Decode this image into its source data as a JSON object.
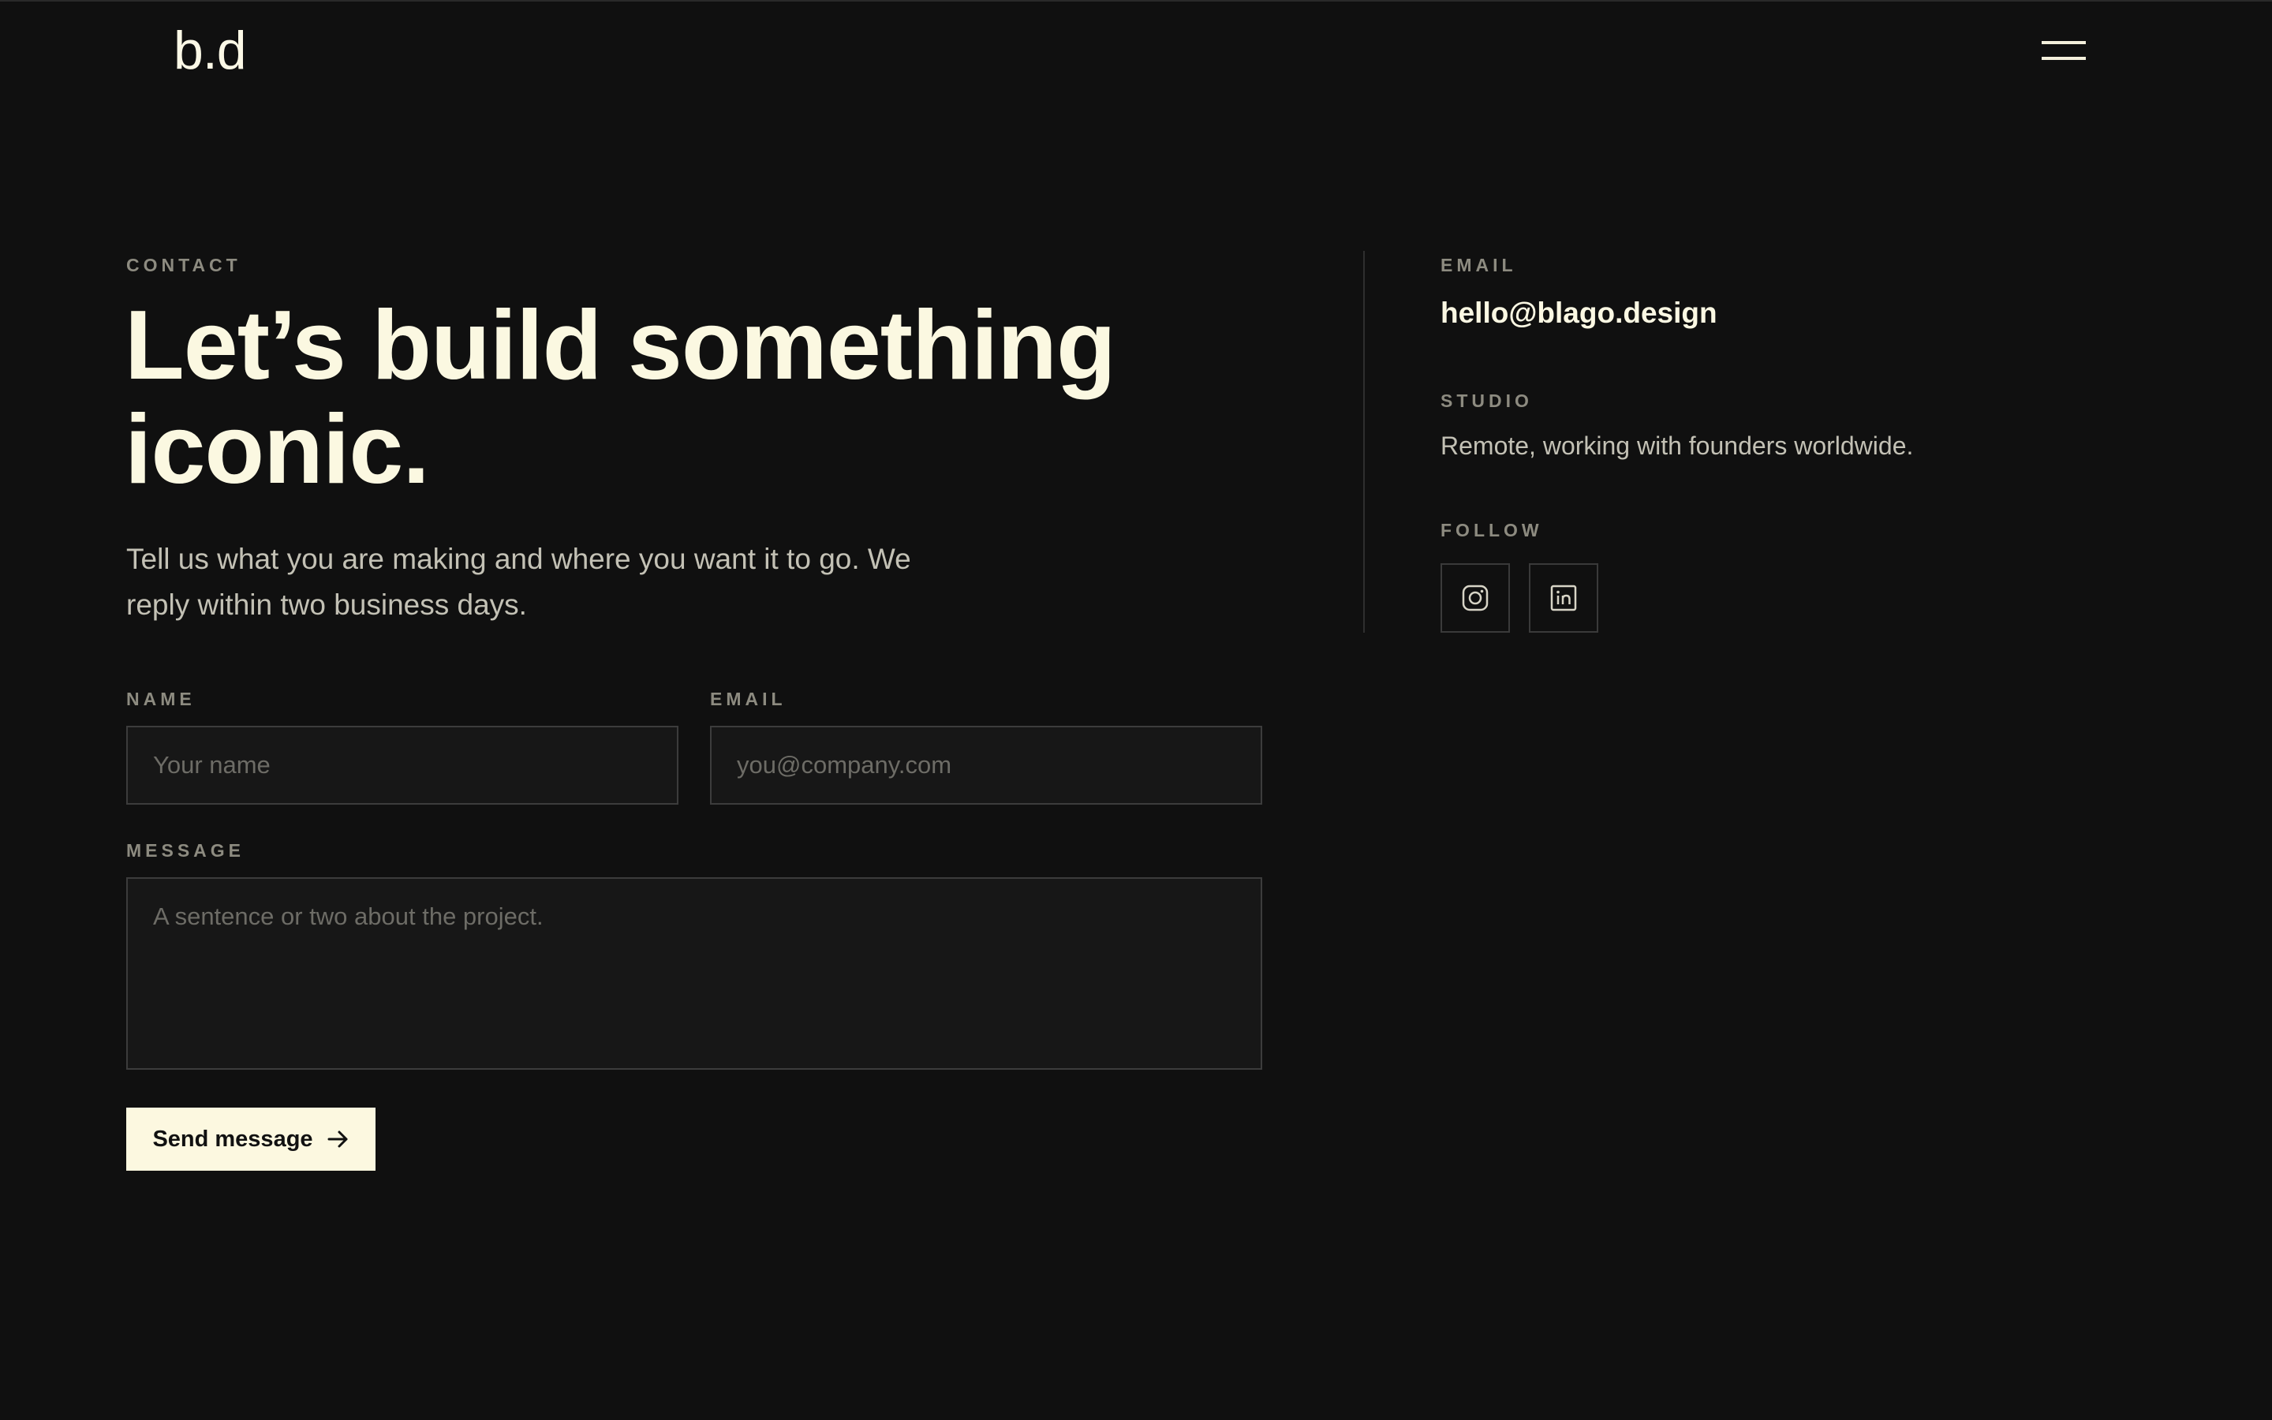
{
  "header": {
    "logo": "b.d",
    "menu_icon": "hamburger-menu-icon"
  },
  "hero": {
    "eyebrow": "CONTACT",
    "headline": "Let’s build something iconic.",
    "lead": "Tell us what you are making and where you want it to go. We reply within two business days."
  },
  "form": {
    "name_label": "NAME",
    "name_placeholder": "Your name",
    "email_label": "EMAIL",
    "email_placeholder": "you@company.com",
    "message_label": "MESSAGE",
    "message_placeholder": "A sentence or two about the project.",
    "submit_label": "Send message",
    "submit_icon": "arrow-right-icon"
  },
  "aside": {
    "email_label": "EMAIL",
    "email_value": "hello@blago.design",
    "studio_label": "STUDIO",
    "studio_value": "Remote, working with founders worldwide.",
    "follow_label": "FOLLOW",
    "social": [
      {
        "icon": "instagram-icon"
      },
      {
        "icon": "linkedin-icon"
      }
    ]
  },
  "colors": {
    "background": "#101010",
    "accent": "#fcf8e0",
    "muted": "#8d8b80",
    "field_bg": "#171717",
    "field_border": "#3c3c3c"
  }
}
